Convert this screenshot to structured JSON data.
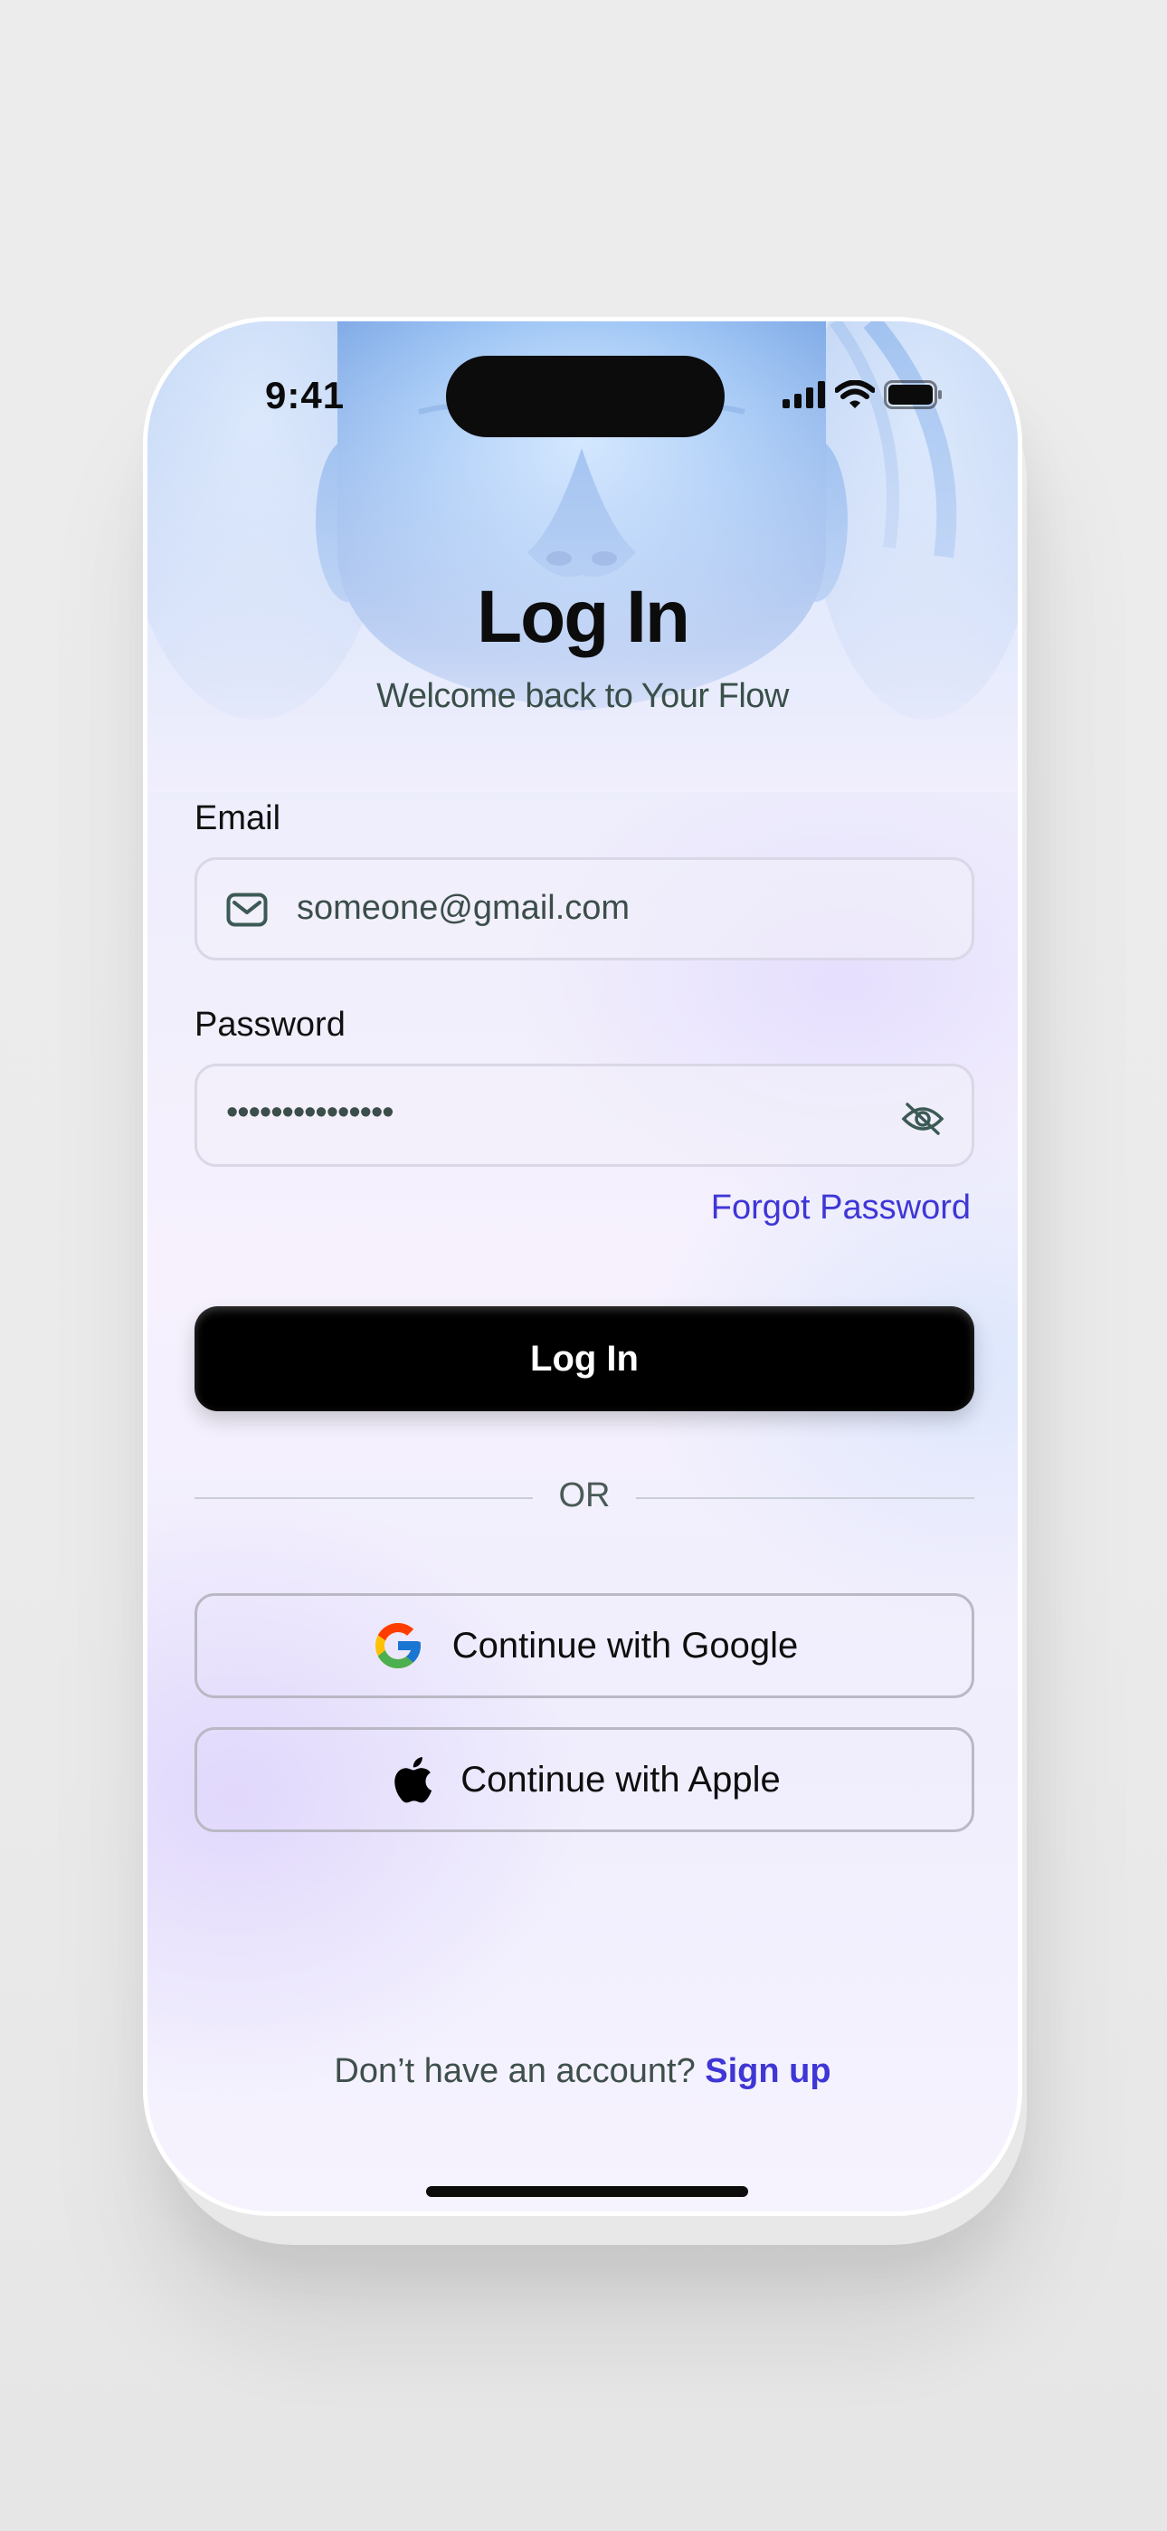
{
  "status_bar": {
    "time": "9:41"
  },
  "header": {
    "title": "Log In",
    "subtitle": "Welcome back to Your Flow"
  },
  "form": {
    "email_label": "Email",
    "email_value": "someone@gmail.com",
    "password_label": "Password",
    "password_masked": "•••••••••••••••",
    "forgot_password": "Forgot Password",
    "login_button": "Log In"
  },
  "divider": {
    "text": "OR"
  },
  "social": {
    "google_label": "Continue with Google",
    "apple_label": "Continue with Apple"
  },
  "footer": {
    "prompt": "Don’t have an account?",
    "signup": "Sign up"
  },
  "icons": {
    "mail": "mail-icon",
    "eye_off": "eye-off-icon",
    "google": "google-icon",
    "apple": "apple-icon",
    "signal": "cellular-signal-icon",
    "wifi": "wifi-icon",
    "battery": "battery-icon"
  },
  "colors": {
    "accent": "#3f36d6",
    "primary_button": "#000000",
    "text_secondary": "#3c4e4a"
  }
}
